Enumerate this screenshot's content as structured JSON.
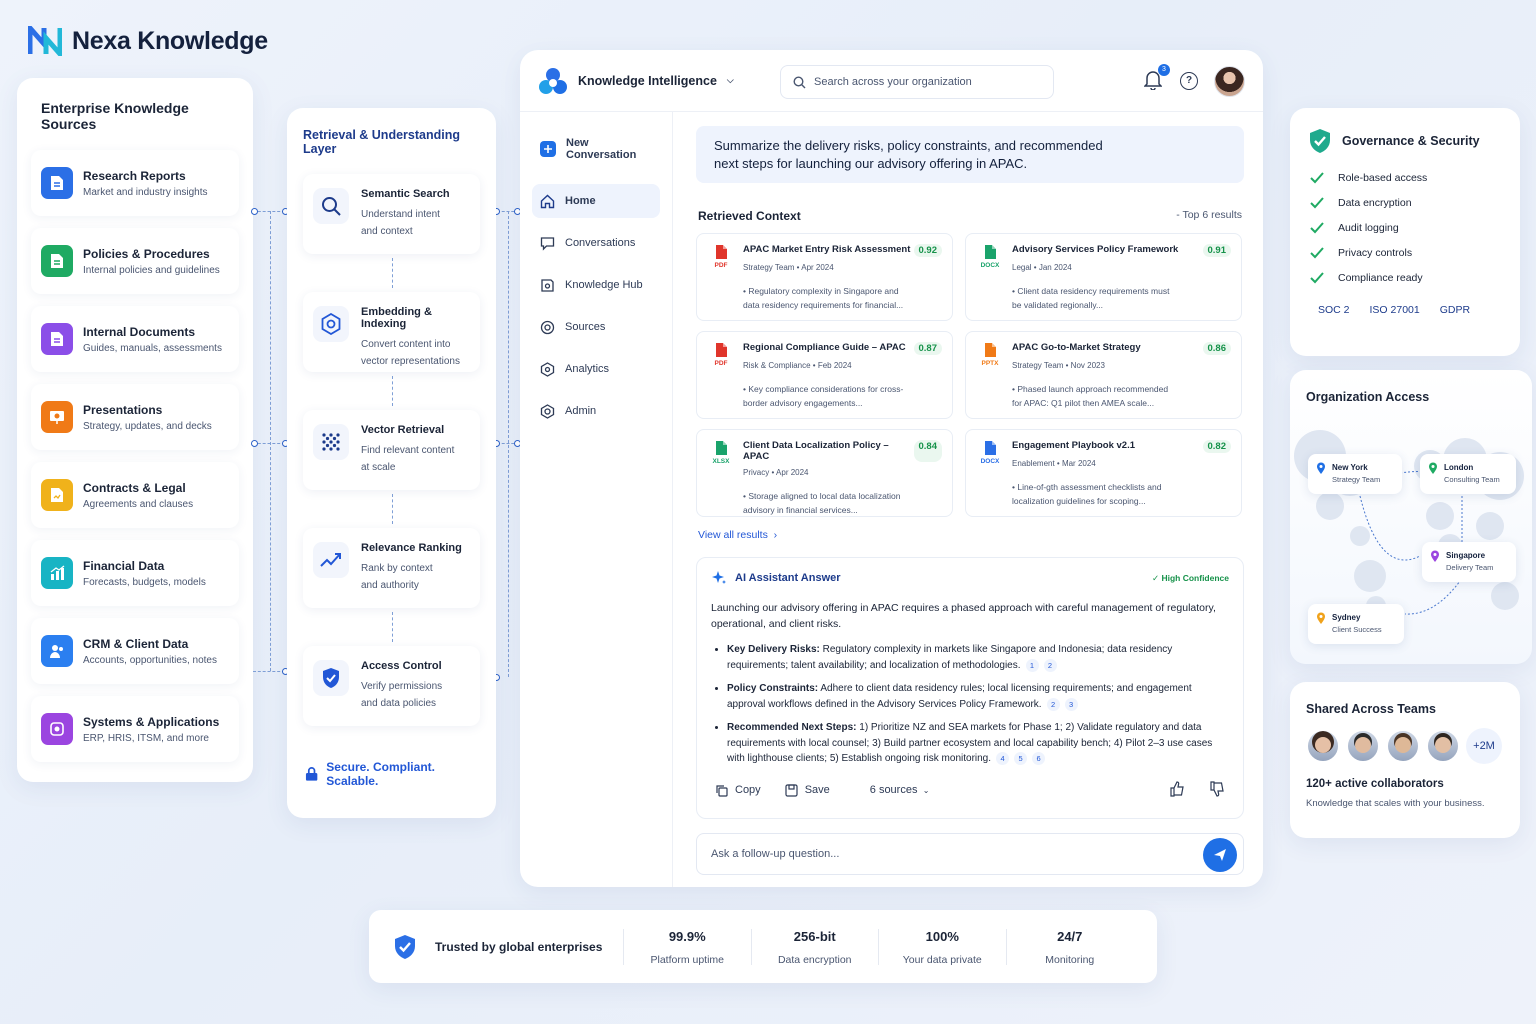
{
  "brand": {
    "name": "Nexa Knowledge"
  },
  "sources": {
    "title": "Enterprise Knowledge Sources",
    "items": [
      {
        "title": "Research Reports",
        "subtitle": "Market and industry insights",
        "icon": "document-icon",
        "color": "#2b6fe6"
      },
      {
        "title": "Policies & Procedures",
        "subtitle": "Internal policies and guidelines",
        "icon": "document-icon",
        "color": "#1faa63"
      },
      {
        "title": "Internal Documents",
        "subtitle": "Guides, manuals, assessments",
        "icon": "document-icon",
        "color": "#8b4ee8"
      },
      {
        "title": "Presentations",
        "subtitle": "Strategy, updates, and decks",
        "icon": "presentation-icon",
        "color": "#f07a17"
      },
      {
        "title": "Contracts & Legal",
        "subtitle": "Agreements and clauses",
        "icon": "contract-icon",
        "color": "#f0b21b"
      },
      {
        "title": "Financial Data",
        "subtitle": "Forecasts, budgets, models",
        "icon": "chart-icon",
        "color": "#18b4c4"
      },
      {
        "title": "CRM & Client Data",
        "subtitle": "Accounts, opportunities, notes",
        "icon": "users-icon",
        "color": "#2b7ff0"
      },
      {
        "title": "Systems & Applications",
        "subtitle": "ERP, HRIS, ITSM, and more",
        "icon": "settings-icon",
        "color": "#9b45e0"
      }
    ]
  },
  "layer": {
    "title": "Retrieval & Understanding Layer",
    "steps": [
      {
        "title": "Semantic Search",
        "line1": "Understand intent",
        "line2": "and context",
        "icon": "search-icon"
      },
      {
        "title": "Embedding & Indexing",
        "line1": "Convert content into",
        "line2": "vector representations",
        "icon": "hexagon-icon"
      },
      {
        "title": "Vector Retrieval",
        "line1": "Find relevant content",
        "line2": "at scale",
        "icon": "grid-dots-icon"
      },
      {
        "title": "Relevance Ranking",
        "line1": "Rank by context",
        "line2": "and authority",
        "icon": "trend-icon"
      },
      {
        "title": "Access Control",
        "line1": "Verify permissions",
        "line2": "and data policies",
        "icon": "shield-check-icon"
      }
    ],
    "footer": "Secure. Compliant. Scalable."
  },
  "app": {
    "workspace": "Knowledge Intelligence",
    "search_placeholder": "Search across your organization",
    "notif_count": "3",
    "nav": [
      {
        "label": "New Conversation",
        "icon": "plus-icon"
      },
      {
        "label": "Home",
        "icon": "home-icon"
      },
      {
        "label": "Conversations",
        "icon": "chat-icon"
      },
      {
        "label": "Knowledge Hub",
        "icon": "book-icon"
      },
      {
        "label": "Sources",
        "icon": "target-icon"
      },
      {
        "label": "Analytics",
        "icon": "analytics-icon"
      },
      {
        "label": "Admin",
        "icon": "gear-icon"
      }
    ],
    "query_line1": "Summarize the delivery risks, policy constraints, and recommended",
    "query_line2": "next steps for launching our advisory offering in APAC.",
    "context_title": "Retrieved Context",
    "context_count": "Top 6 results",
    "docs": [
      {
        "title": "APAC Market Entry Risk Assessment",
        "score": "0.92",
        "meta": "Strategy Team  •  Apr 2024",
        "ex1": "• Regulatory complexity in Singapore and",
        "ex2": "data residency requirements for financial...",
        "type": "PDF",
        "color": "#e0352b"
      },
      {
        "title": "Advisory Services Policy Framework",
        "score": "0.91",
        "meta": "Legal  •  Jan 2024",
        "ex1": "• Client data residency requirements must",
        "ex2": "be validated regionally...",
        "type": "DOCX",
        "color": "#1aa36b"
      },
      {
        "title": "Regional Compliance Guide – APAC",
        "score": "0.87",
        "meta": "Risk & Compliance  •  Feb 2024",
        "ex1": "• Key compliance considerations for cross-",
        "ex2": "border advisory engagements...",
        "type": "PDF",
        "color": "#e0352b"
      },
      {
        "title": "APAC Go-to-Market Strategy",
        "score": "0.86",
        "meta": "Strategy Team  •  Nov 2023",
        "ex1": "• Phased launch approach recommended",
        "ex2": "for APAC: Q1 pilot then AMEA scale...",
        "type": "PPTX",
        "color": "#f07a17"
      },
      {
        "title": "Client Data Localization Policy – APAC",
        "score": "0.84",
        "meta": "Privacy  •  Apr 2024",
        "ex1": "• Storage aligned to local data localization",
        "ex2": "advisory in financial services...",
        "type": "XLSX",
        "color": "#1aa36b"
      },
      {
        "title": "Engagement Playbook v2.1",
        "score": "0.82",
        "meta": "Enablement  •  Mar 2024",
        "ex1": "• Line-of-gth assessment checklists and",
        "ex2": "localization guidelines for scoping...",
        "type": "DOCX",
        "color": "#2b6fe6"
      }
    ],
    "view_all": "View all results",
    "answer": {
      "title": "AI Assistant Answer",
      "confidence": "High Confidence",
      "intro": "Launching our advisory offering in APAC requires a phased approach with careful management of regulatory, operational, and client risks.",
      "bullets": [
        {
          "label": "Key Delivery Risks:",
          "text": " Regulatory complexity in markets like Singapore and Indonesia; data residency requirements; talent availability; and localization of methodologies.",
          "cites": [
            "1",
            "2"
          ]
        },
        {
          "label": "Policy Constraints:",
          "text": " Adhere to client data residency rules; local licensing requirements; and engagement approval workflows defined in the Advisory Services Policy Framework.",
          "cites": [
            "2",
            "3"
          ]
        },
        {
          "label": "Recommended Next Steps:",
          "text": " 1) Prioritize NZ and SEA markets for Phase 1;  2) Validate regulatory and data requirements with local counsel;  3) Build partner ecosystem and local capability bench;  4) Pilot 2–3 use cases with lighthouse clients;  5) Establish ongoing risk monitoring.",
          "cites": [
            "4",
            "5",
            "6"
          ]
        }
      ],
      "copy": "Copy",
      "save": "Save",
      "sources": "6 sources"
    },
    "followup_placeholder": "Ask a follow-up question..."
  },
  "governance": {
    "title": "Governance & Security",
    "items": [
      "Role-based access",
      "Data encryption",
      "Audit logging",
      "Privacy controls",
      "Compliance ready"
    ],
    "certs": [
      "SOC 2",
      "ISO 27001",
      "GDPR"
    ]
  },
  "org": {
    "title": "Organization Access",
    "locations": [
      {
        "city": "New York",
        "team": "Strategy Team"
      },
      {
        "city": "London",
        "team": "Consulting Team"
      },
      {
        "city": "Singapore",
        "team": "Delivery Team"
      },
      {
        "city": "Sydney",
        "team": "Client Success"
      }
    ]
  },
  "shared": {
    "title": "Shared Across Teams",
    "more": "+2M",
    "count": "120+ active collaborators",
    "desc": "Knowledge that scales with your business."
  },
  "trust": {
    "label": "Trusted by global enterprises",
    "stats": [
      {
        "value": "99.9%",
        "label": "Platform uptime"
      },
      {
        "value": "256-bit",
        "label": "Data encryption"
      },
      {
        "value": "100%",
        "label": "Your data private"
      },
      {
        "value": "24/7",
        "label": "Monitoring"
      }
    ]
  }
}
